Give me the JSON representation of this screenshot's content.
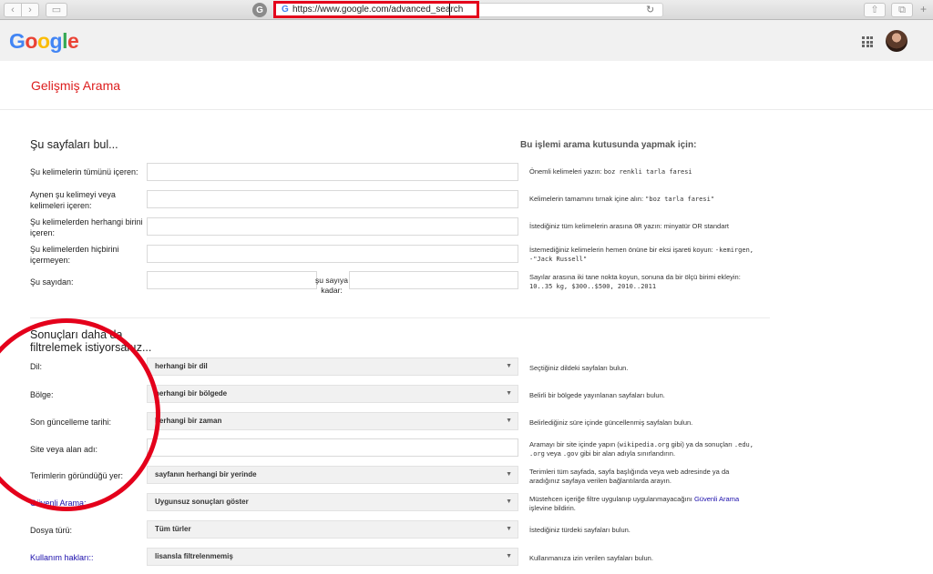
{
  "browser": {
    "url": "https://www.google.com/advanced_search",
    "favicon": "G",
    "ext_badge": "G",
    "back_icon": "‹",
    "forward_icon": "›",
    "sidebar_icon": "▭",
    "share_icon": "⇧",
    "tabs_icon": "⧉",
    "plus_icon": "+",
    "reload_icon": "↻"
  },
  "header": {
    "logo": [
      {
        "ch": "G",
        "color": "#4285F4"
      },
      {
        "ch": "o",
        "color": "#EA4335"
      },
      {
        "ch": "o",
        "color": "#FBBC05"
      },
      {
        "ch": "g",
        "color": "#4285F4"
      },
      {
        "ch": "l",
        "color": "#34A853"
      },
      {
        "ch": "e",
        "color": "#EA4335"
      }
    ]
  },
  "page_title": "Gelişmiş Arama",
  "find_section": {
    "heading": "Şu sayfaları bul...",
    "hint_heading": "Bu işlemi arama kutusunda yapmak için:",
    "rows": [
      {
        "label": "Şu kelimelerin tümünü içeren:",
        "hint_text": "Önemli kelimeleri yazın: ",
        "hint_mono": "boz renkli tarla faresi",
        "hint_after": ""
      },
      {
        "label": "Aynen şu kelimeyi veya kelimeleri içeren:",
        "hint_text": "Kelimelerin tamamını tırnak içine alın: ",
        "hint_mono": "\"boz tarla faresi\"",
        "hint_after": ""
      },
      {
        "label": "Şu kelimelerden herhangi birini içeren:",
        "hint_text": "İstediğiniz tüm kelimelerin arasına ",
        "hint_mono": "OR",
        "hint_after": " yazın: minyatür OR standart"
      },
      {
        "label": "Şu kelimelerden hiçbirini içermeyen:",
        "hint_text": "İstemediğiniz kelimelerin hemen önüne bir eksi işareti koyun: ",
        "hint_mono": "-kemirgen, -\"Jack Russell\"",
        "hint_after": ""
      },
      {
        "label": "Şu sayıdan:",
        "hint_text": "Sayılar arasına iki tane nokta koyun, sonuna da bir ölçü birimi ekleyin: ",
        "hint_mono": "10..35 kg, $300..$500, 2010..2011",
        "hint_after": ""
      }
    ],
    "range_to_label": "şu sayıya kadar:"
  },
  "filter_section": {
    "heading": "Sonuçları daha da filtrelemek istiyorsanız...",
    "rows": [
      {
        "label": "Dil:",
        "value": "herhangi bir dil",
        "hint": "Seçtiğiniz dildeki sayfaları bulun.",
        "blue": false
      },
      {
        "label": "Bölge:",
        "value": "herhangi bir bölgede",
        "hint": "Belirli bir bölgede yayınlanan sayfaları bulun.",
        "blue": false
      },
      {
        "label": "Son güncelleme tarihi:",
        "value": "herhangi bir zaman",
        "hint": "Belirlediğiniz süre içinde güncellenmiş sayfaları bulun.",
        "blue": false
      },
      {
        "label": "Site veya alan adı:",
        "value": "",
        "hint": "",
        "blue": false
      },
      {
        "label": "Terimlerin göründüğü yer:",
        "value": "sayfanın herhangi bir yerinde",
        "hint": "Terimleri tüm sayfada, sayfa başlığında veya web adresinde ya da aradığınız sayfaya verilen bağlantılarda arayın.",
        "blue": false
      },
      {
        "label": "Güvenli Arama:",
        "value": "Uygunsuz sonuçları göster",
        "hint": "",
        "blue": true
      },
      {
        "label": "Dosya türü:",
        "value": "Tüm türler",
        "hint": "İstediğiniz türdeki sayfaları bulun.",
        "blue": false
      },
      {
        "label": "Kullanım hakları::",
        "value": "lisansla filtrelenmemiş",
        "hint": "Kullanmanıza izin verilen sayfaları bulun.",
        "blue": true
      }
    ],
    "site_hint": {
      "t1": "Aramayı bir site içinde yapın (",
      "m1": "wikipedia.org",
      "t2": " gibi) ya da sonuçları ",
      "m2": ".edu, .org",
      "t3": " veya ",
      "m3": ".gov",
      "t4": " gibi bir alan adıyla sınırlandırın."
    },
    "safe_hint": {
      "before": "Müstehcen içeriğe filtre uygulanıp uygulanmayacağını ",
      "link": "Güvenli Arama",
      "after": " işlevine bildirin."
    },
    "select_arrow": "▼"
  }
}
